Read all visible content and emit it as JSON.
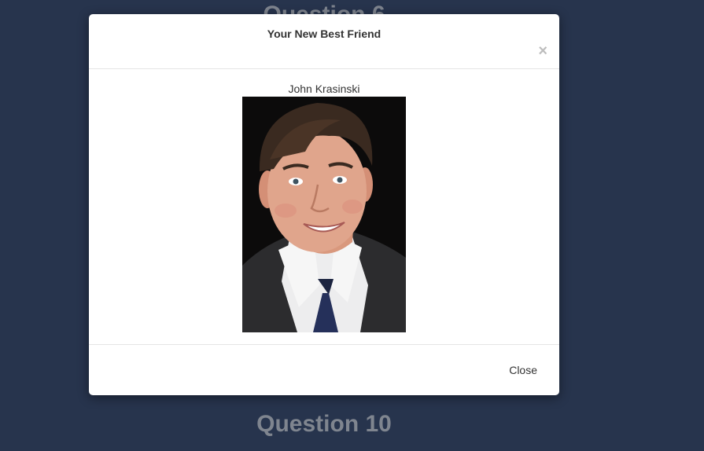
{
  "background": {
    "top_heading": "Question 6",
    "bottom_heading": "Question 10"
  },
  "modal": {
    "title": "Your New Best Friend",
    "close_icon": "close-icon",
    "close_glyph": "×",
    "person_name": "John Krasinski",
    "photo": "portrait-photo",
    "footer_close_label": "Close"
  },
  "colors": {
    "page_background": "#27344d",
    "modal_background": "#ffffff",
    "background_heading": "#7f858f",
    "text": "#333333"
  }
}
